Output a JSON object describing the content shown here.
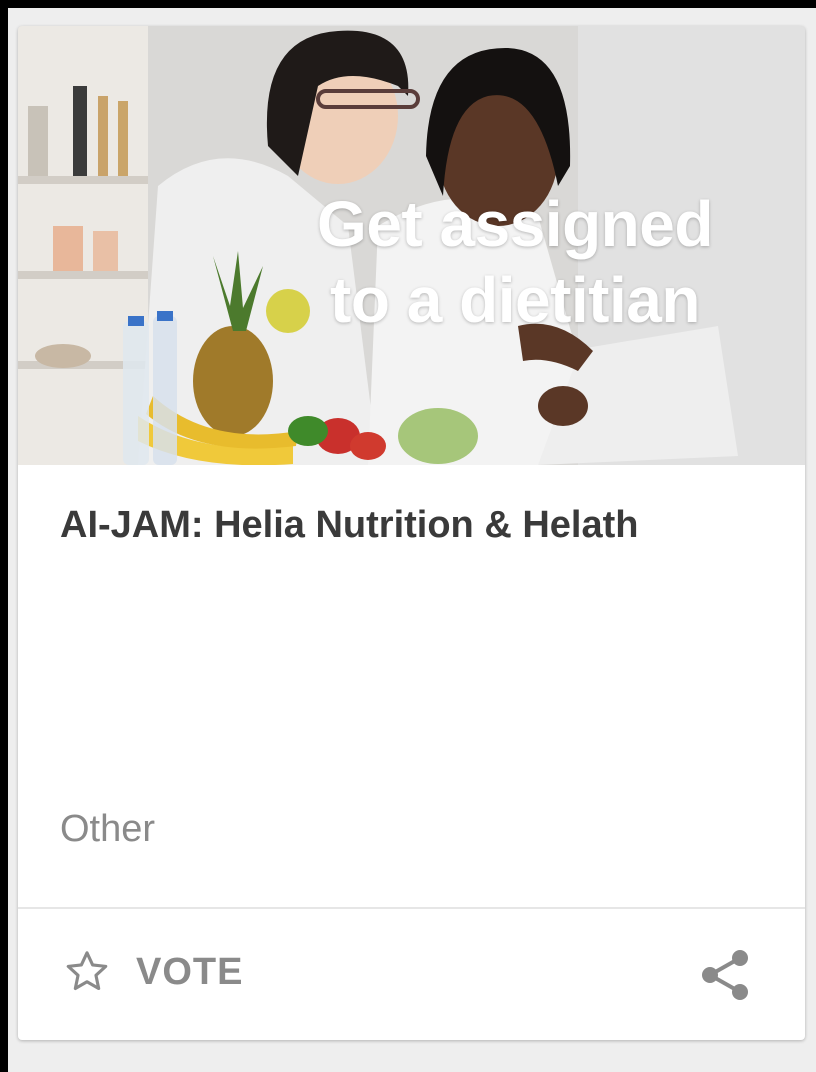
{
  "card": {
    "hero_caption_line1": "Get assigned",
    "hero_caption_line2": "to a dietitian",
    "title": "AI-JAM: Helia Nutrition & Helath",
    "category": "Other",
    "vote_label": "VOTE"
  },
  "icons": {
    "vote": "star-outline-icon",
    "share": "share-icon"
  },
  "colors": {
    "title": "#3a3a3a",
    "muted": "#8a8a8a",
    "card_bg": "#ffffff",
    "page_bg": "#eeeeee"
  }
}
